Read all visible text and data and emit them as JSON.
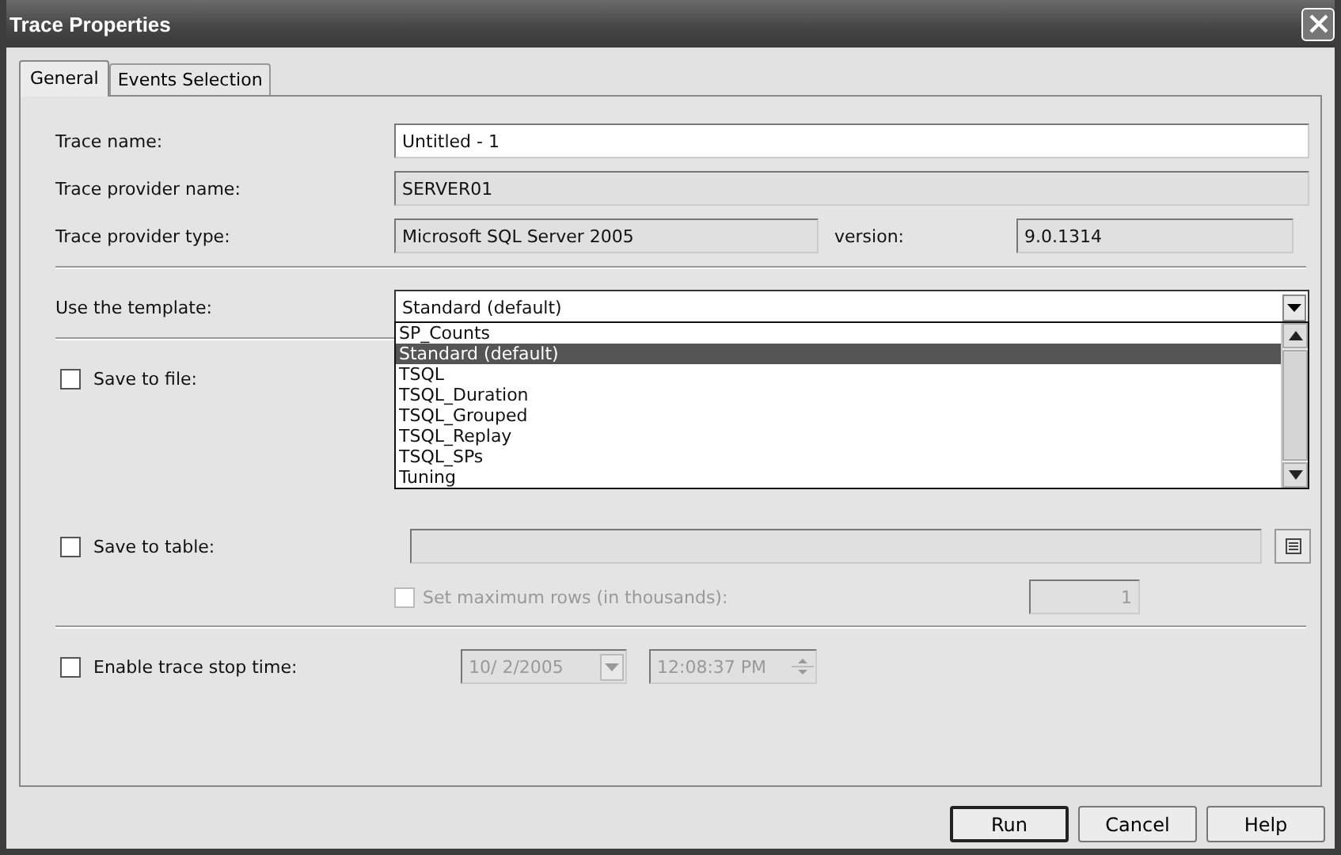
{
  "window": {
    "title": "Trace Properties"
  },
  "tabs": [
    {
      "label": "General",
      "selected": true
    },
    {
      "label": "Events Selection",
      "selected": false
    }
  ],
  "trace_name": {
    "label": "Trace name:",
    "value": "Untitled - 1",
    "disabled": false
  },
  "provider_name": {
    "label": "Trace provider name:",
    "value": "SERVER01",
    "disabled": true
  },
  "provider_type": {
    "label": "Trace provider type:",
    "value": "Microsoft SQL Server 2005",
    "disabled": true
  },
  "version": {
    "label": "version:",
    "value": "9.0.1314",
    "disabled": true
  },
  "template": {
    "label": "Use the template:",
    "value": "Standard (default)",
    "expanded": true,
    "options": [
      {
        "label": "SP_Counts",
        "selected": false
      },
      {
        "label": "Standard (default)",
        "selected": true
      },
      {
        "label": "TSQL",
        "selected": false
      },
      {
        "label": "TSQL_Duration",
        "selected": false
      },
      {
        "label": "TSQL_Grouped",
        "selected": false
      },
      {
        "label": "TSQL_Replay",
        "selected": false
      },
      {
        "label": "TSQL_SPs",
        "selected": false
      },
      {
        "label": "Tuning",
        "selected": false
      }
    ]
  },
  "save_to_file": {
    "label": "Save to file:",
    "checked": false
  },
  "save_to_table": {
    "label": "Save to table:",
    "checked": false,
    "value_disabled": true
  },
  "max_rows": {
    "label": "Set maximum rows (in thousands):",
    "checked": false,
    "disabled": true,
    "value": "1"
  },
  "stop_time": {
    "label": "Enable trace stop time:",
    "checked": false,
    "disabled": true,
    "date": "10/  2/2005",
    "time": "12:08:37 PM"
  },
  "buttons": [
    {
      "label": "Run",
      "default": true
    },
    {
      "label": "Cancel",
      "default": false
    },
    {
      "label": "Help",
      "default": false
    }
  ]
}
